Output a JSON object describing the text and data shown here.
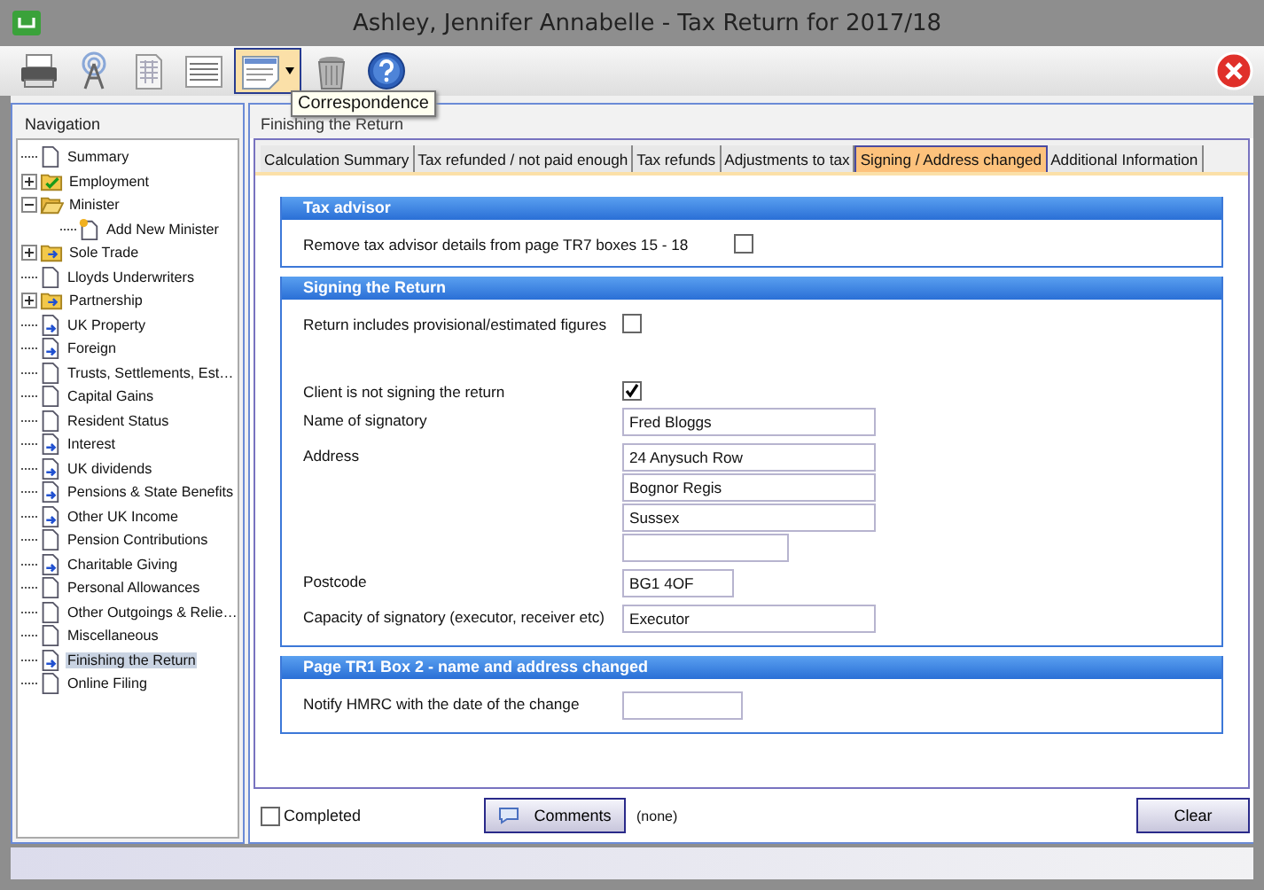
{
  "window": {
    "title": "Ashley, Jennifer Annabelle - Tax Return for 2017/18"
  },
  "toolbar": {
    "buttons": [
      {
        "kind": "printer",
        "selected": false
      },
      {
        "kind": "antenna",
        "selected": false
      },
      {
        "kind": "spreadsheet",
        "selected": false
      },
      {
        "kind": "list",
        "selected": false
      },
      {
        "kind": "letter",
        "selected": true
      },
      {
        "kind": "trash",
        "selected": false
      },
      {
        "kind": "help",
        "selected": false
      }
    ],
    "tooltip": "Correspondence"
  },
  "navigation": {
    "title": "Navigation",
    "items": [
      {
        "label": "Summary",
        "kind": "page",
        "selected": false
      },
      {
        "label": "Employment",
        "kind": "checked-folder",
        "selected": false,
        "expanded": false
      },
      {
        "label": "Minister",
        "kind": "open-folder",
        "selected": false,
        "expanded": true,
        "children": [
          {
            "label": "Add New Minister",
            "kind": "new",
            "selected": false
          }
        ]
      },
      {
        "label": "Sole Trade",
        "kind": "folder",
        "selected": false,
        "expanded": false
      },
      {
        "label": "Lloyds Underwriters",
        "kind": "page",
        "selected": false
      },
      {
        "label": "Partnership",
        "kind": "folder",
        "selected": false,
        "expanded": false
      },
      {
        "label": "UK Property",
        "kind": "linked-page",
        "selected": false
      },
      {
        "label": "Foreign",
        "kind": "linked-page",
        "selected": false
      },
      {
        "label": "Trusts, Settlements, Est…",
        "kind": "page",
        "selected": false
      },
      {
        "label": "Capital Gains",
        "kind": "page",
        "selected": false
      },
      {
        "label": "Resident Status",
        "kind": "page",
        "selected": false
      },
      {
        "label": "Interest",
        "kind": "linked-page",
        "selected": false
      },
      {
        "label": "UK dividends",
        "kind": "linked-page",
        "selected": false
      },
      {
        "label": "Pensions & State Benefits",
        "kind": "linked-page",
        "selected": false
      },
      {
        "label": "Other UK Income",
        "kind": "linked-page",
        "selected": false
      },
      {
        "label": "Pension Contributions",
        "kind": "page",
        "selected": false
      },
      {
        "label": "Charitable Giving",
        "kind": "linked-page",
        "selected": false
      },
      {
        "label": "Personal Allowances",
        "kind": "page",
        "selected": false
      },
      {
        "label": "Other Outgoings & Relie…",
        "kind": "page",
        "selected": false
      },
      {
        "label": "Miscellaneous",
        "kind": "page",
        "selected": false
      },
      {
        "label": "Finishing the Return",
        "kind": "linked-page",
        "selected": true
      },
      {
        "label": "Online Filing",
        "kind": "page",
        "selected": false
      }
    ]
  },
  "page_title": "Finishing the Return",
  "tabs": [
    {
      "label": "Calculation Summary",
      "selected": false
    },
    {
      "label": "Tax refunded / not paid enough",
      "selected": false
    },
    {
      "label": "Tax refunds",
      "selected": false
    },
    {
      "label": "Adjustments to tax",
      "selected": false
    },
    {
      "label": "Signing / Address changed",
      "selected": true
    },
    {
      "label": "Additional Information",
      "selected": false
    }
  ],
  "sections": [
    {
      "title": "Tax advisor",
      "rows": [
        {
          "kind": "checkbox",
          "label": "Remove tax advisor details from page TR7 boxes 15 - 18",
          "checked": false
        }
      ]
    },
    {
      "title": "Signing the Return",
      "rows": [
        {
          "kind": "checkbox",
          "label": "Return includes provisional/estimated figures",
          "checked": false
        },
        {
          "kind": "spacer"
        },
        {
          "kind": "checkbox",
          "label": "Client is not signing the return",
          "checked": true
        },
        {
          "kind": "text",
          "label": "Name of signatory",
          "value": "Fred Bloggs"
        },
        {
          "kind": "address",
          "label": "Address",
          "lines": [
            "24 Anysuch Row",
            "Bognor Regis",
            "Sussex"
          ]
        },
        {
          "kind": "extra-line"
        },
        {
          "kind": "postcode",
          "label": "Postcode",
          "value": "BG1 4OF"
        },
        {
          "kind": "text",
          "label": "Capacity of signatory (executor, receiver etc)",
          "value": "Executor"
        }
      ]
    },
    {
      "title": "Page TR1 Box 2 - name and address changed",
      "rows": [
        {
          "kind": "date",
          "label": "Notify HMRC with the date of the change"
        }
      ]
    }
  ],
  "footer": {
    "completed": {
      "label": "Completed",
      "checked": false
    },
    "comments_button": "Comments",
    "comments_status": "(none)",
    "clear_button": "Clear"
  }
}
